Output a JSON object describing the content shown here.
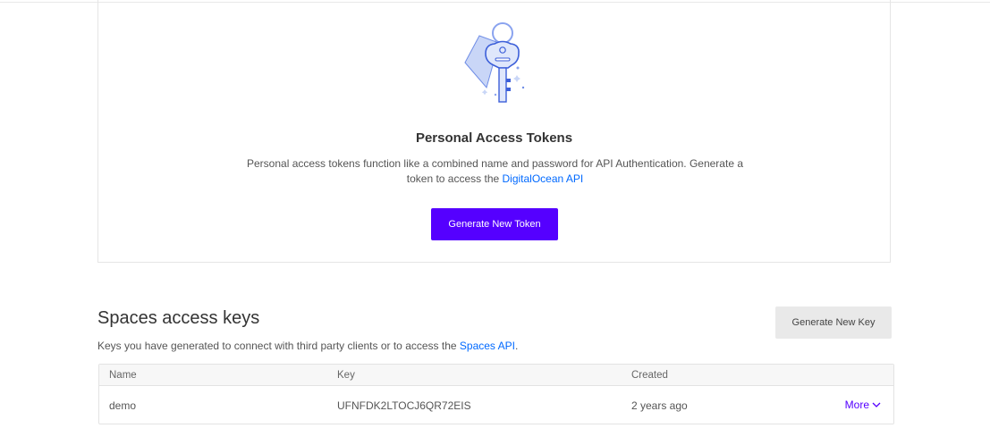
{
  "personal_tokens": {
    "title": "Personal Access Tokens",
    "desc_before": "Personal access tokens function like a combined name and password for API Authentication. Generate a token to access the ",
    "link": "DigitalOcean API",
    "button": "Generate New Token",
    "illustration": "key-icon"
  },
  "spaces": {
    "title": "Spaces access keys",
    "desc_before": "Keys you have generated to connect with third party clients or to access the ",
    "link": "Spaces API",
    "desc_after": ".",
    "button": "Generate New Key",
    "columns": [
      "Name",
      "Key",
      "Created"
    ],
    "rows": [
      {
        "name": "demo",
        "key": "UFNFDK2LTOCJ6QR72EIS",
        "created": "2 years ago",
        "action": "More"
      }
    ]
  },
  "colors": {
    "accent": "#5500ff",
    "link": "#0069ff",
    "border": "#e5e5e5"
  }
}
